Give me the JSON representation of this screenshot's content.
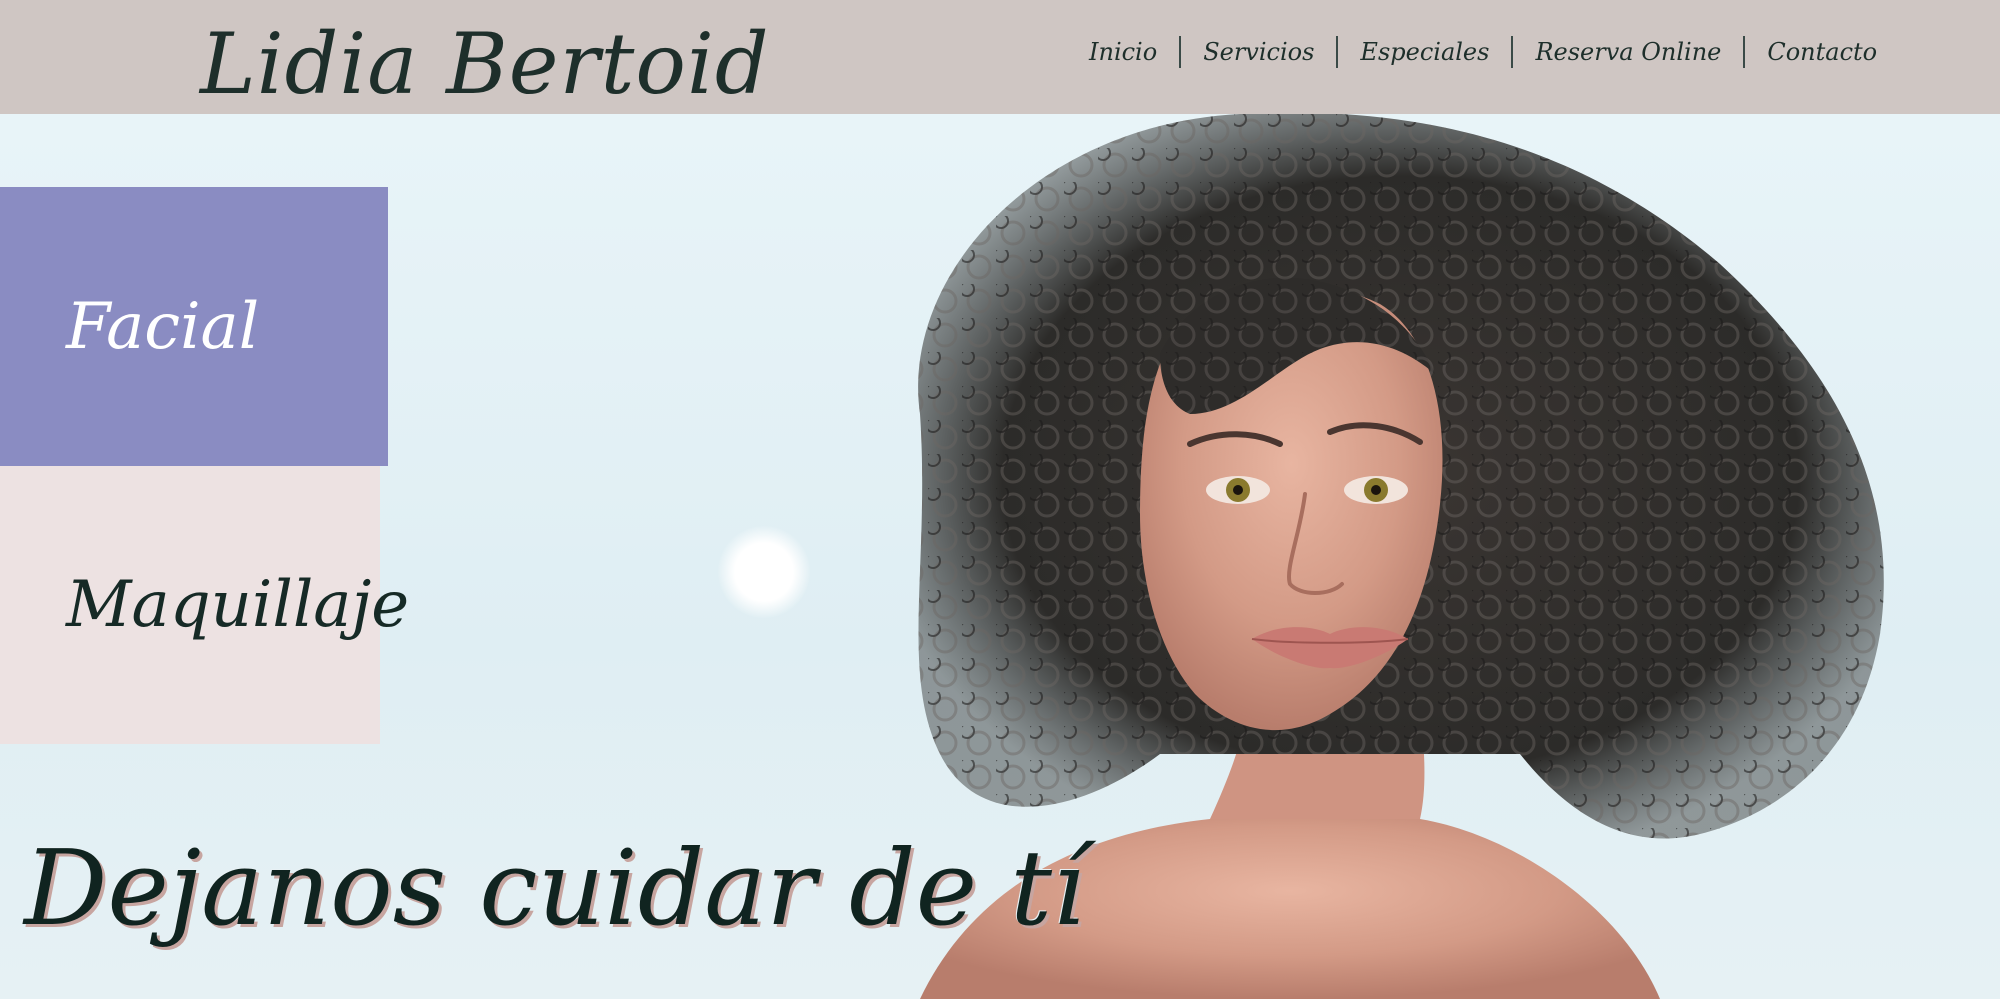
{
  "header": {
    "brand": "Lidia Bertoid",
    "nav": [
      {
        "label": "Inicio"
      },
      {
        "label": "Servicios"
      },
      {
        "label": "Especiales"
      },
      {
        "label": "Reserva Online"
      },
      {
        "label": "Contacto"
      }
    ]
  },
  "hero": {
    "tiles": [
      {
        "label": "Facial"
      },
      {
        "label": "Maquillaje"
      }
    ],
    "tagline": "Dejanos cuidar de tí"
  },
  "colors": {
    "header_bg": "#cfc6c3",
    "facial_tile": "#8a8cc2",
    "maquillaje_tile": "#ede2e2",
    "text_dark": "#1e2f2b",
    "hero_bg": "#e8f4f8"
  }
}
